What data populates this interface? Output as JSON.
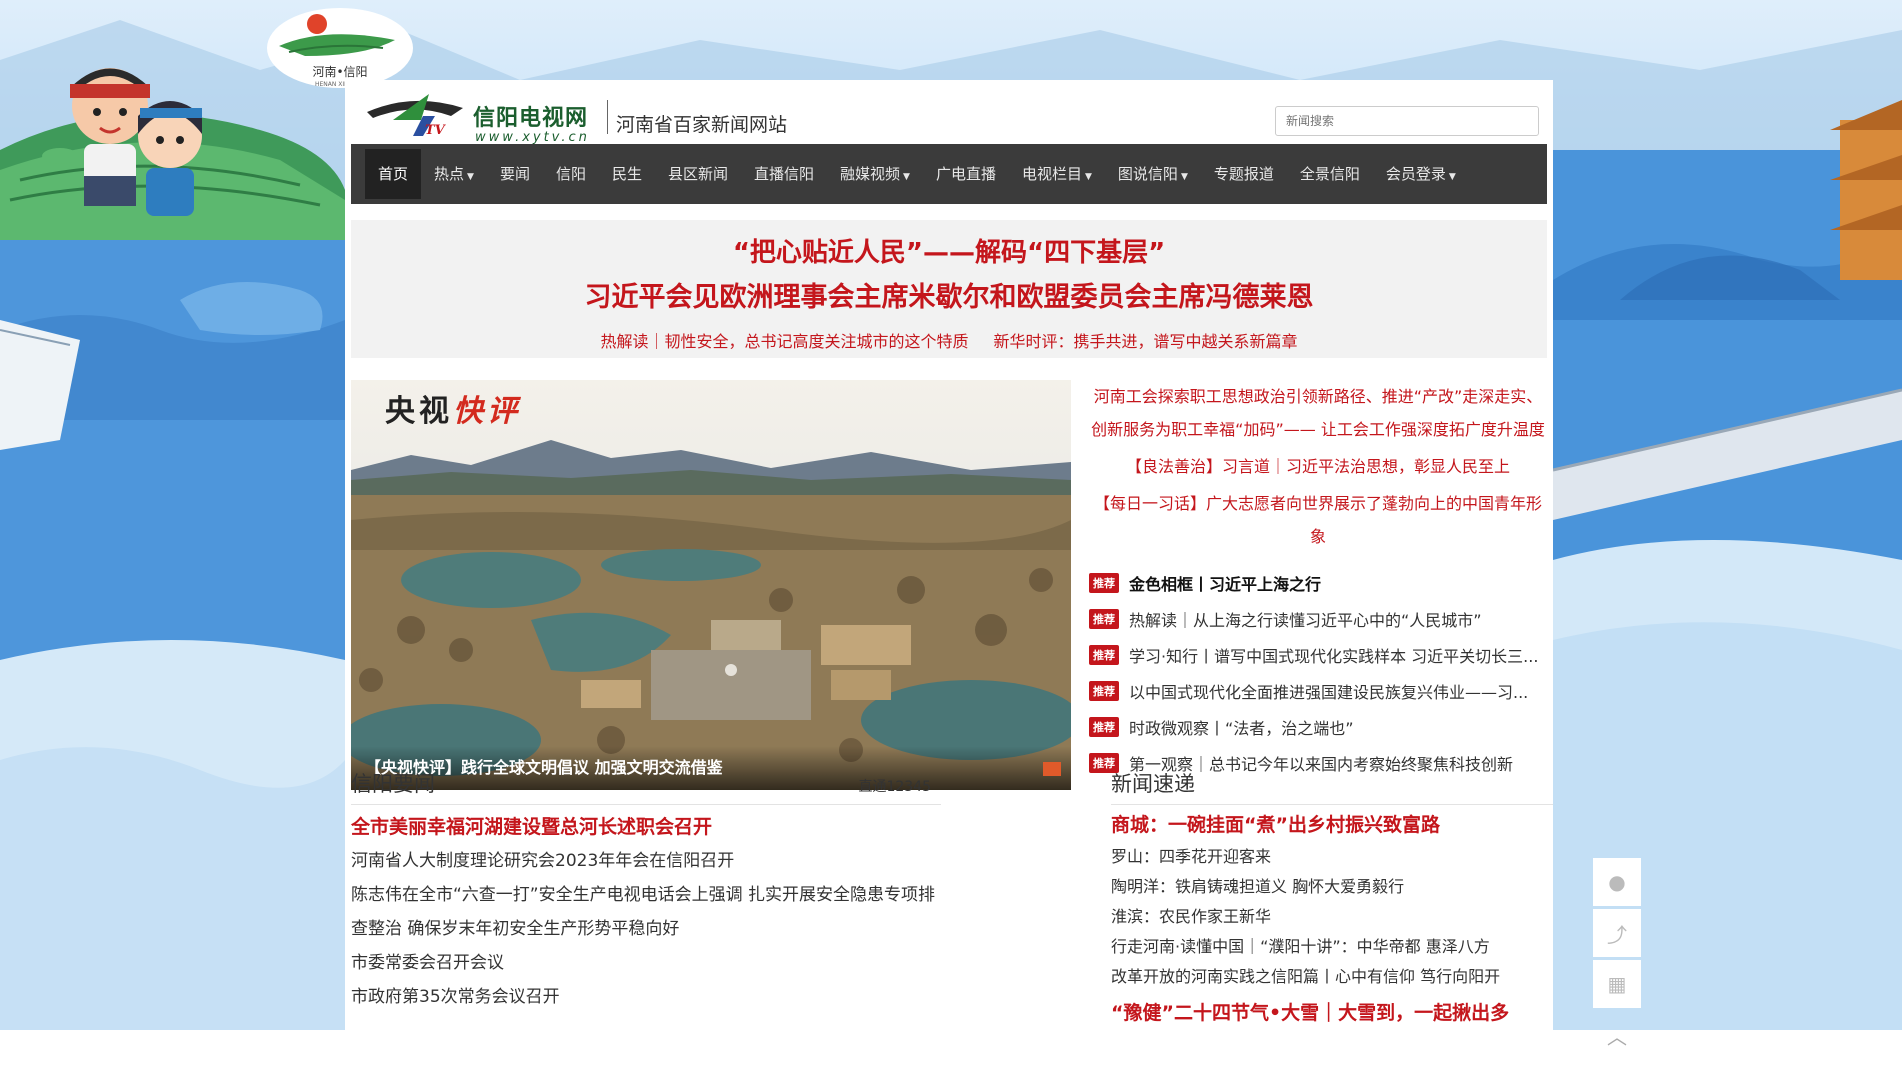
{
  "badge": {
    "text": "河南•信阳",
    "sub": "HENAN XINYANG"
  },
  "site": {
    "logo_title": "信阳电视网",
    "logo_url": "www.xytv.cn",
    "slogan": "河南省百家新闻网站",
    "search_placeholder": "新闻搜索"
  },
  "nav": {
    "items": [
      {
        "label": "首页",
        "dropdown": false
      },
      {
        "label": "热点",
        "dropdown": true
      },
      {
        "label": "要闻",
        "dropdown": false
      },
      {
        "label": "信阳",
        "dropdown": false
      },
      {
        "label": "民生",
        "dropdown": false
      },
      {
        "label": "县区新闻",
        "dropdown": false
      },
      {
        "label": "直播信阳",
        "dropdown": false
      },
      {
        "label": "融媒视频",
        "dropdown": true
      },
      {
        "label": "广电直播",
        "dropdown": false
      },
      {
        "label": "电视栏目",
        "dropdown": true
      },
      {
        "label": "图说信阳",
        "dropdown": true
      },
      {
        "label": "专题报道",
        "dropdown": false
      },
      {
        "label": "全景信阳",
        "dropdown": false
      },
      {
        "label": "会员登录",
        "dropdown": true
      }
    ]
  },
  "headline": {
    "line1": "“把心贴近人民”——解码“四下基层”",
    "line2": "习近平会见欧洲理事会主席米歇尔和欧盟委员会主席冯德莱恩",
    "sub1": "热解读｜韧性安全，总书记高度关注城市的这个特质",
    "sub2": "新华时评：携手共进，谱写中越关系新篇章"
  },
  "hero": {
    "brand_plain": "央视",
    "brand_accent": "快评",
    "caption": "【央视快评】践行全球文明倡议 加强文明交流借鉴"
  },
  "right": {
    "red_links": [
      "河南工会探索职工思想政治引领新路径、推进“产改”走深走实、创新服务为职工幸福“加码”—— 让工会工作强深度拓广度升温度",
      "【良法善治】习言道｜习近平法治思想，彰显人民至上",
      "【每日一习话】广大志愿者向世界展示了蓬勃向上的中国青年形象"
    ],
    "rec_tag": "推荐",
    "recommends": [
      "金色相框丨习近平上海之行",
      "热解读｜从上海之行读懂习近平心中的“人民城市”",
      "学习·知行丨谱写中国式现代化实践样本 习近平关切长三...",
      "以中国式现代化全面推进强国建设民族复兴伟业——习...",
      "时政微观察丨“法者，治之端也”",
      "第一观察｜总书记今年以来国内考察始终聚焦科技创新"
    ]
  },
  "xinyang_news": {
    "title": "信阳要闻",
    "more": "直通12345",
    "lead": "全市美丽幸福河湖建设暨总河长述职会召开",
    "items": [
      "河南省人大制度理论研究会2023年年会在信阳召开",
      "陈志伟在全市“六查一打”安全生产电视电话会上强调 扎实开展安全隐患专项排查整治 确保岁末年初安全生产形势平稳向好",
      "市委常委会召开会议",
      "市政府第35次常务会议召开"
    ]
  },
  "express_news": {
    "title": "新闻速递",
    "lead": "商城：一碗挂面“煮”出乡村振兴致富路",
    "items": [
      "罗山：四季花开迎客来",
      "陶明洋：铁肩铸魂担道义 胸怀大爱勇毅行",
      "淮滨：农民作家王新华",
      "行走河南·读懂中国｜“濮阳十讲”：中华帝都 惠泽八方",
      "改革开放的河南实践之信阳篇丨心中有信仰 笃行向阳开"
    ],
    "partial": "“豫健”二十四节气•大雪｜大雪到，一起揪出多"
  },
  "colors": {
    "accent_red": "#c4161c",
    "nav_bg": "#3b3b3b"
  }
}
